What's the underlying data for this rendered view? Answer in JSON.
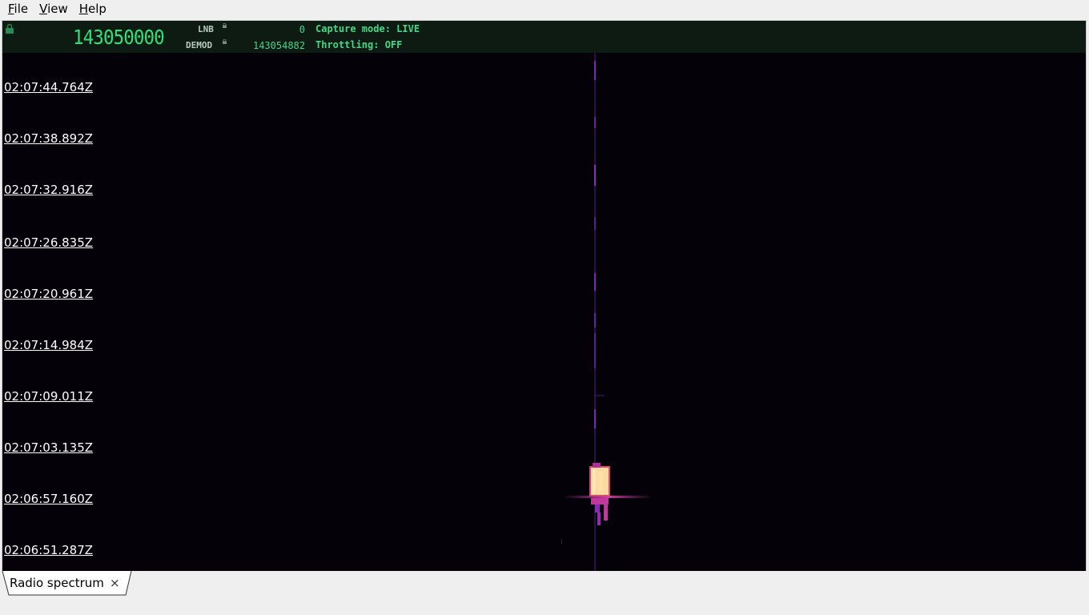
{
  "menu": {
    "items": [
      {
        "label": "File",
        "mnemonic": "F",
        "rest": "ile"
      },
      {
        "label": "View",
        "mnemonic": "V",
        "rest": "iew"
      },
      {
        "label": "Help",
        "mnemonic": "H",
        "rest": "elp"
      }
    ]
  },
  "header": {
    "frequency": "143050000",
    "lnb_label": "LNB",
    "lnb_value": "0",
    "demod_label": "DEMOD",
    "demod_value": "143054882",
    "capture_mode": "Capture mode: LIVE",
    "throttling": "Throttling: OFF"
  },
  "waterfall": {
    "timestamps": [
      "02:07:44.764Z",
      "02:07:38.892Z",
      "02:07:32.916Z",
      "02:07:26.835Z",
      "02:07:20.961Z",
      "02:07:14.984Z",
      "02:07:09.011Z",
      "02:07:03.135Z",
      "02:06:57.160Z",
      "02:06:51.287Z"
    ]
  },
  "tabs": [
    {
      "label": "Radio spectrum",
      "close": "×"
    }
  ],
  "colors": {
    "accent_green": "#2fe07a",
    "header_bg": "#0d1b12",
    "waterfall_bg": "#040208",
    "signal_hot": "#ffd9a0",
    "signal_mid": "#c0389e"
  },
  "icons": [
    "lock-icon",
    "lnb-lock-icon",
    "demod-lock-icon",
    "close-icon"
  ]
}
